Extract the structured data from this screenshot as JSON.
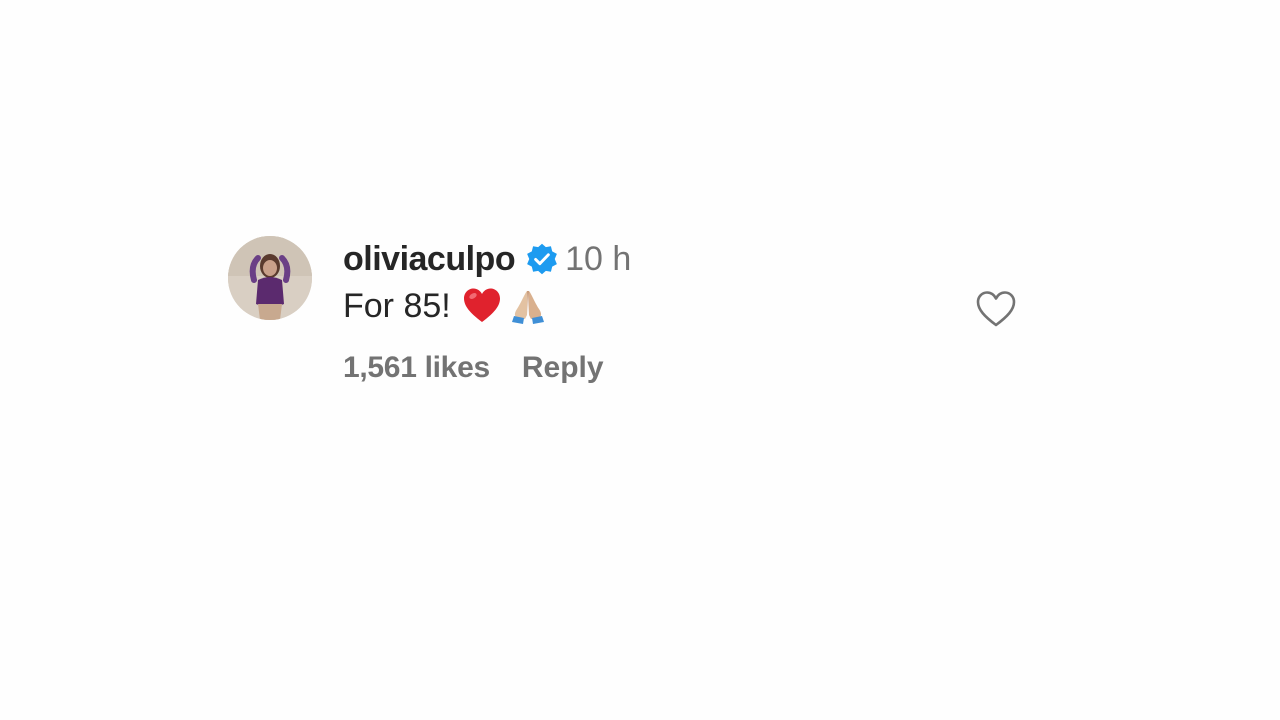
{
  "comment": {
    "username": "oliviaculpo",
    "verified": true,
    "timestamp": "10 h",
    "text": "For 85!",
    "emojis": [
      "red-heart-emoji",
      "folded-hands-emoji"
    ],
    "likes": "1,561 likes",
    "reply_label": "Reply",
    "liked": false
  },
  "colors": {
    "username": "#262626",
    "secondary_text": "#737373",
    "verified_badge": "#1d9bf0",
    "heart_emoji": "#e0222d"
  }
}
